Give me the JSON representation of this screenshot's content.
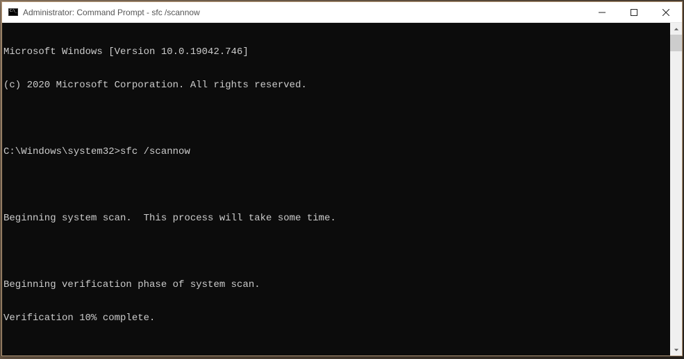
{
  "window": {
    "title": "Administrator: Command Prompt - sfc  /scannow"
  },
  "terminal": {
    "lines": [
      "Microsoft Windows [Version 10.0.19042.746]",
      "(c) 2020 Microsoft Corporation. All rights reserved.",
      "",
      "C:\\Windows\\system32>sfc /scannow",
      "",
      "Beginning system scan.  This process will take some time.",
      "",
      "Beginning verification phase of system scan.",
      "Verification 10% complete."
    ]
  }
}
